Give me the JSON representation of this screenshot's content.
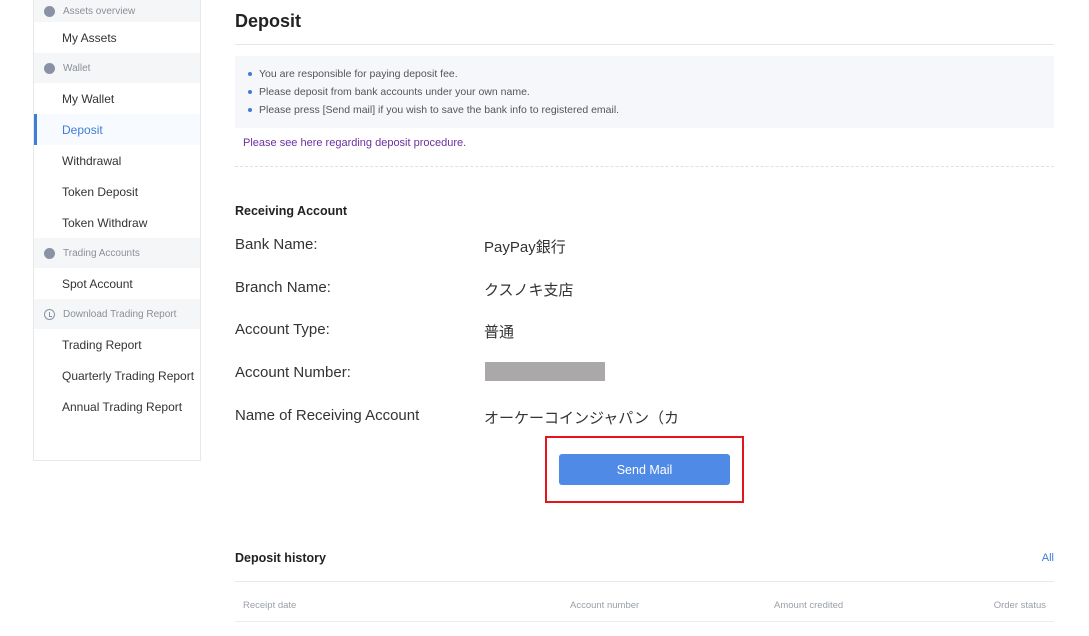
{
  "sidebar": {
    "sections": [
      {
        "title": "Assets overview",
        "items": [
          "My Assets"
        ]
      },
      {
        "title": "Wallet",
        "items": [
          "My Wallet",
          "Deposit",
          "Withdrawal",
          "Token Deposit",
          "Token Withdraw"
        ]
      },
      {
        "title": "Trading Accounts",
        "items": [
          "Spot Account"
        ]
      },
      {
        "title": "Download Trading Report",
        "items": [
          "Trading Report",
          "Quarterly Trading Report",
          "Annual Trading Report"
        ]
      }
    ],
    "active_item": "Deposit"
  },
  "page": {
    "title": "Deposit",
    "notices": [
      "You are responsible for paying deposit fee.",
      "Please deposit from bank accounts under your own name.",
      "Please press [Send mail] if you wish to save the bank info to registered email."
    ],
    "procedure_link": "Please see here regarding deposit procedure."
  },
  "receiving_account": {
    "heading": "Receiving Account",
    "rows": [
      {
        "label": "Bank Name:",
        "value": "PayPay銀行"
      },
      {
        "label": "Branch Name:",
        "value": "クスノキ支店"
      },
      {
        "label": "Account Type:",
        "value": "普通"
      },
      {
        "label": "Account Number:",
        "value": ""
      },
      {
        "label": "Name of Receiving Account",
        "value": "オーケーコインジャパン（カ"
      }
    ],
    "send_mail_label": "Send Mail"
  },
  "deposit_history": {
    "heading": "Deposit history",
    "all_link": "All",
    "columns": [
      "Receipt date",
      "Account number",
      "Amount credited",
      "Order status"
    ]
  },
  "colors": {
    "accent": "#3d7fd6",
    "button": "#4f8ae6",
    "highlight": "#e4161b",
    "link": "#6b2fa0"
  }
}
